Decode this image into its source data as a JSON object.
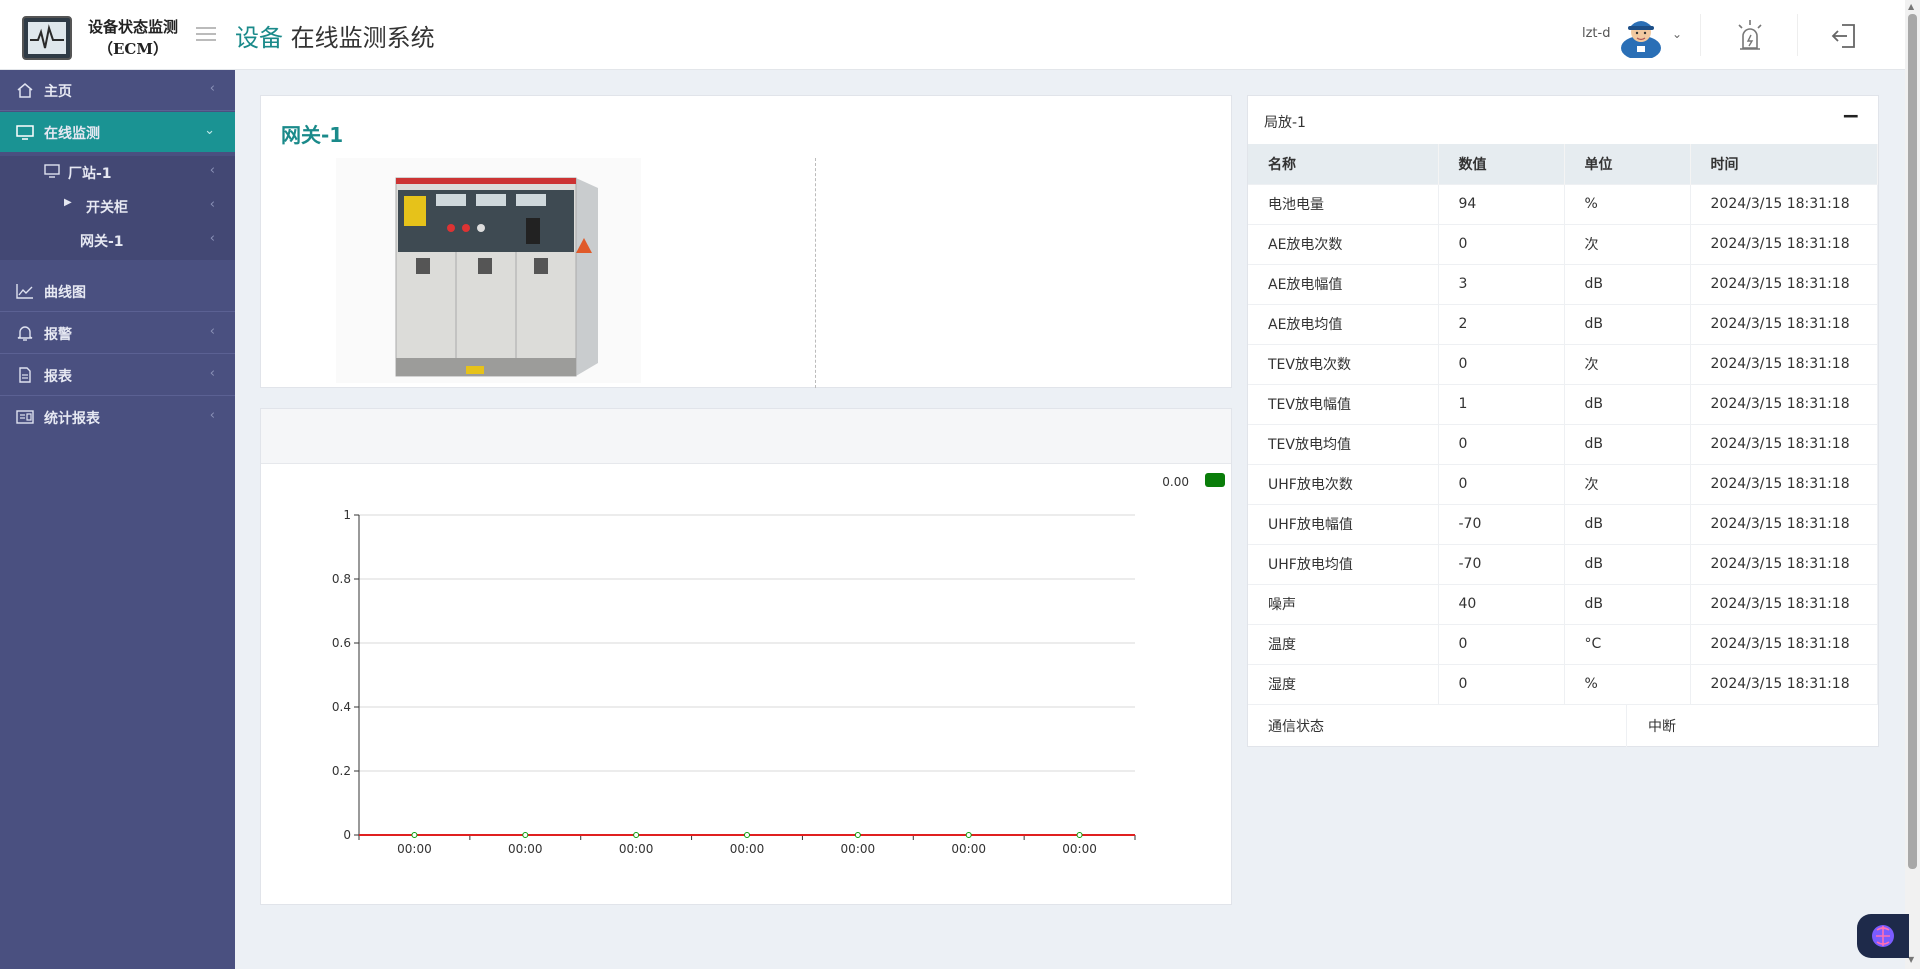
{
  "header": {
    "logo_line1": "设备状态监测",
    "logo_line2": "（ECM）",
    "title_accent": "设备",
    "title_rest": " 在线监测系统",
    "user_name": "lzt-d"
  },
  "sidebar": {
    "items": [
      {
        "label": "主页",
        "icon": "home-icon"
      },
      {
        "label": "在线监测",
        "icon": "monitor-icon"
      },
      {
        "label": "曲线图",
        "icon": "line-chart-icon"
      },
      {
        "label": "报警",
        "icon": "bell-icon"
      },
      {
        "label": "报表",
        "icon": "document-icon"
      },
      {
        "label": "统计报表",
        "icon": "stats-icon"
      }
    ],
    "sub_items": [
      {
        "label": "厂站-1"
      },
      {
        "label": "开关柜"
      },
      {
        "label": "网关-1"
      }
    ]
  },
  "gateway": {
    "title": "网关-1"
  },
  "chart_data": {
    "type": "line",
    "x": [
      "00:00",
      "00:00",
      "00:00",
      "00:00",
      "00:00",
      "00:00",
      "00:00"
    ],
    "series": [
      {
        "values": [
          0,
          0,
          0,
          0,
          0,
          0,
          0
        ],
        "color": "#e02020"
      }
    ],
    "ylim": [
      0,
      1
    ],
    "yticks": [
      "0",
      "0.2",
      "0.4",
      "0.6",
      "0.8",
      "1"
    ],
    "legend_value": "0.00",
    "legend_color": "#0a7d0a",
    "legend_position": "top-right",
    "grid": true
  },
  "table": {
    "title": "局放-1",
    "columns": [
      "名称",
      "数值",
      "单位",
      "时间"
    ],
    "rows": [
      [
        "电池电量",
        "94",
        "%",
        "2024/3/15 18:31:18"
      ],
      [
        "AE放电次数",
        "0",
        "次",
        "2024/3/15 18:31:18"
      ],
      [
        "AE放电幅值",
        "3",
        "dB",
        "2024/3/15 18:31:18"
      ],
      [
        "AE放电均值",
        "2",
        "dB",
        "2024/3/15 18:31:18"
      ],
      [
        "TEV放电次数",
        "0",
        "次",
        "2024/3/15 18:31:18"
      ],
      [
        "TEV放电幅值",
        "1",
        "dB",
        "2024/3/15 18:31:18"
      ],
      [
        "TEV放电均值",
        "0",
        "dB",
        "2024/3/15 18:31:18"
      ],
      [
        "UHF放电次数",
        "0",
        "次",
        "2024/3/15 18:31:18"
      ],
      [
        "UHF放电幅值",
        "-70",
        "dB",
        "2024/3/15 18:31:18"
      ],
      [
        "UHF放电均值",
        "-70",
        "dB",
        "2024/3/15 18:31:18"
      ],
      [
        "噪声",
        "40",
        "dB",
        "2024/3/15 18:31:18"
      ],
      [
        "温度",
        "0",
        "°C",
        "2024/3/15 18:31:18"
      ],
      [
        "湿度",
        "0",
        "%",
        "2024/3/15 18:31:18"
      ]
    ],
    "status_label": "通信状态",
    "status_value": "中断"
  },
  "colors": {
    "accent": "#1a8a8a",
    "sidebar_bg": "#4a5080",
    "active_bg": "#1a9393"
  }
}
